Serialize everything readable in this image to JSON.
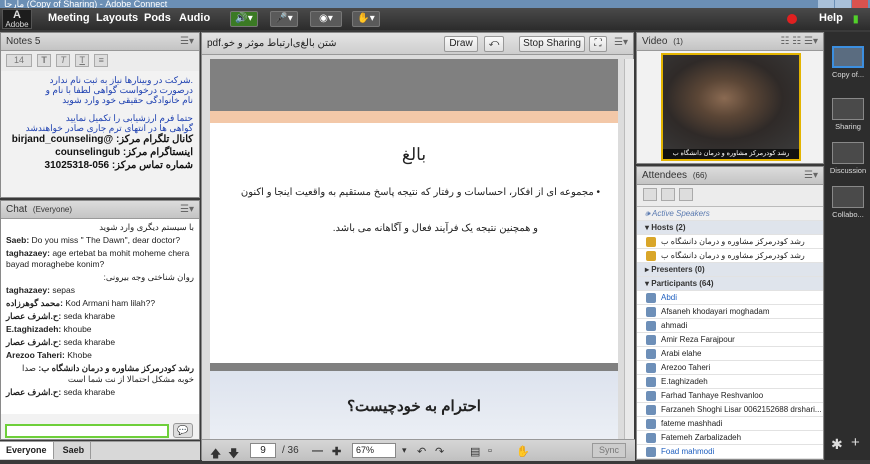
{
  "window": {
    "title": "مارجا (Copy of Sharing) - Adobe Connect"
  },
  "menubar": {
    "logo": "Adobe",
    "items": [
      "Meeting",
      "Layouts",
      "Pods",
      "Audio"
    ],
    "help": "Help"
  },
  "notes": {
    "title": "Notes 5",
    "font_size": "14",
    "lines": [
      ".شرکت در وبینارها نیاز به ثبت نام ندارد",
      "درصورت درخواست گواهی لطفا با نام و",
      "نام خانوادگی حقیقی خود وارد شوید",
      "حتما فرم ارزشیابی را تکمیل نمایید",
      "گواهی ها در انتهای ترم جاری صادر خواهندشد",
      "کانال تلگرام مرکز: @birjand_counseling",
      "اینستاگرام مرکز: counselingub",
      "شماره تماس مرکز: 056-31025318"
    ]
  },
  "chat": {
    "title": "Chat",
    "scope": "(Everyone)",
    "messages": [
      {
        "sender": "",
        "text": "با سیستم دیگری وارد شوید"
      },
      {
        "sender": "Saeb:",
        "text": "Do you miss \" The Dawn\", dear doctor?"
      },
      {
        "sender": "taghazaey:",
        "text": "age ertebat ba mohit moheme chera bayad moraghebe konim?"
      },
      {
        "sender": "",
        "text": "روان شناختی وجه بیرونی:"
      },
      {
        "sender": "taghazaey:",
        "text": "sepas"
      },
      {
        "sender": "محمد گوهرزاده:",
        "text": "Kod Armani ham lilah??"
      },
      {
        "sender": "ح.اشرف عصار:",
        "text": "seda kharabe"
      },
      {
        "sender": "E.taghizadeh:",
        "text": "khoube"
      },
      {
        "sender": "ح.اشرف عصار:",
        "text": "seda kharabe"
      },
      {
        "sender": "Arezoo Taheri:",
        "text": "Khobe"
      },
      {
        "sender": "رشد کودرمرکز مشاوره و درمان دانشگاه ب:",
        "text": "صدا خوبه مشکل احتمالا از نت شما است"
      },
      {
        "sender": "ح.اشرف عصار:",
        "text": "seda kharabe"
      }
    ],
    "tabs": [
      "Everyone",
      "Saeb"
    ]
  },
  "share": {
    "title": "pdf.شتن بالغ‌ی‌ارتباط موثر و خو",
    "draw_label": "Draw",
    "stop_label": "Stop Sharing",
    "slide1": {
      "title": "بالغ",
      "text1": "• مجموعه ای از افکار، احساسات و رفتار که نتیجه پاسخ مستقیم به واقعیت اینجا و اکنون",
      "text2": "و همچنین نتیجه یک فرآیند فعال و آگاهانه می باشد."
    },
    "slide2": {
      "title": "احترام به خودچیست؟"
    },
    "page": "9",
    "total_pages": "/ 36",
    "zoom": "67%",
    "sync_label": "Sync"
  },
  "video": {
    "title": "Video",
    "count": "(1)",
    "label": "رشد کودرمرکز مشاوره و درمان دانشگاه ب"
  },
  "attendees": {
    "title": "Attendees",
    "count": "(66)",
    "active_speakers": "Active Speakers",
    "hosts_label": "Hosts (2)",
    "hosts": [
      "رشد کودرمرکز مشاوره و درمان دانشگاه ب",
      "رشد کودرمرکز مشاوره و درمان دانشگاه ب"
    ],
    "presenters_label": "Presenters (0)",
    "participants_label": "Participants (64)",
    "participants": [
      "Abdi",
      "Afsaneh khodayari moghadam",
      "ahmadi",
      "Amir Reza Farajpour",
      "Arabi elahe",
      "Arezoo Taheri",
      "E.taghizadeh",
      "Farhad Tanhaye Reshvanloo",
      "Farzaneh Shoghi Lisar 0062152688 drshari...",
      "fateme mashhadi",
      "Fatemeh Zarbalizadeh",
      "Foad mahmodi"
    ]
  },
  "layouts_rail": {
    "items": [
      "Copy of...",
      "Sharing",
      "Discussion",
      "Collabo..."
    ]
  }
}
